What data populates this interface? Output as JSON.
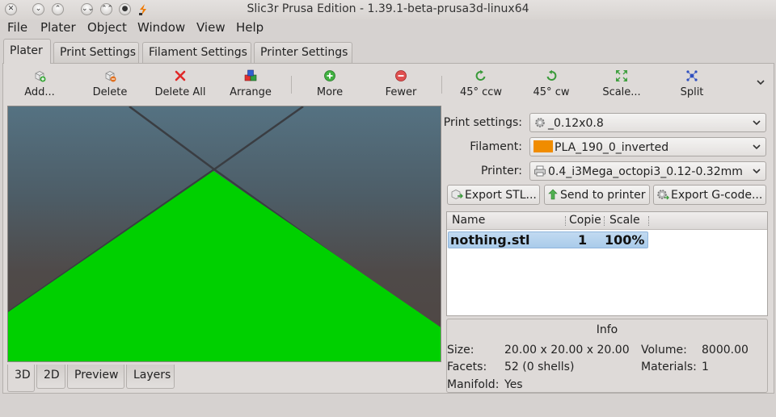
{
  "window": {
    "title": "Slic3r Prusa Edition - 1.39.1-beta-prusa3d-linux64",
    "controls": {
      "close": "✕",
      "minimize": "⌄",
      "maximize": "⌃",
      "keep_below": "⌄⌄",
      "keep_above": "⌃⌃",
      "shade": "●"
    }
  },
  "menu": [
    "File",
    "Plater",
    "Object",
    "Window",
    "View",
    "Help"
  ],
  "tabs": [
    "Plater",
    "Print Settings",
    "Filament Settings",
    "Printer Settings"
  ],
  "active_tab": "Plater",
  "toolbar": {
    "add": "Add...",
    "delete": "Delete",
    "delete_all": "Delete All",
    "arrange": "Arrange",
    "more": "More",
    "fewer": "Fewer",
    "rotate_ccw": "45° ccw",
    "rotate_cw": "45° cw",
    "scale": "Scale...",
    "split": "Split"
  },
  "view_tabs": [
    "3D",
    "2D",
    "Preview",
    "Layers"
  ],
  "active_view": "3D",
  "settings": {
    "print_label": "Print settings:",
    "print_value": "_0.12x0.8",
    "filament_label": "Filament:",
    "filament_value": "PLA_190_0_inverted",
    "filament_color": "#f08c00",
    "printer_label": "Printer:",
    "printer_value": "0.4_i3Mega_octopi3_0.12-0.32mm"
  },
  "actions": {
    "export_stl": "Export STL...",
    "send_to_printer": "Send to printer",
    "export_gcode": "Export G-code..."
  },
  "object_list": {
    "columns": [
      "Name",
      "Copie",
      "Scale"
    ],
    "rows": [
      {
        "name": "nothing.stl",
        "copies": "1",
        "scale": "100%"
      }
    ]
  },
  "info": {
    "title": "Info",
    "size_label": "Size:",
    "size_value": "20.00 x 20.00 x 20.00",
    "volume_label": "Volume:",
    "volume_value": "8000.00",
    "facets_label": "Facets:",
    "facets_value": "52 (0 shells)",
    "materials_label": "Materials:",
    "materials_value": "1",
    "manifold_label": "Manifold:",
    "manifold_value": "Yes"
  },
  "colors": {
    "object_green": "#00d000",
    "selection_blue": "#a9cbea",
    "accent_orange": "#f08c00"
  }
}
